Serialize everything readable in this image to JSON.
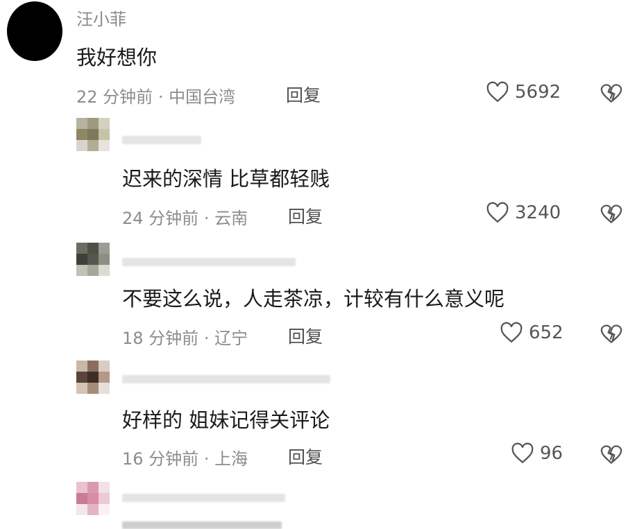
{
  "main_comment": {
    "username": "汪小菲",
    "text": "我好想你",
    "time": "22 分钟前",
    "location": "中国台湾",
    "reply_label": "回复",
    "likes": "5692",
    "avatar_color": "#000000"
  },
  "replies": [
    {
      "text": "迟来的深情 比草都轻贱",
      "time": "24 分钟前",
      "location": "云南",
      "reply_label": "回复",
      "likes": "3240"
    },
    {
      "text": "不要这么说，人走茶凉，计较有什么意义呢",
      "time": "18 分钟前",
      "location": "辽宁",
      "reply_label": "回复",
      "likes": "652"
    },
    {
      "text": "好样的 姐妹记得关评论",
      "time": "16 分钟前",
      "location": "上海",
      "reply_label": "回复",
      "likes": "96"
    },
    {
      "text": ""
    }
  ],
  "separator": "·",
  "icons": {
    "like": "heart-outline-icon",
    "dislike": "broken-heart-icon"
  }
}
